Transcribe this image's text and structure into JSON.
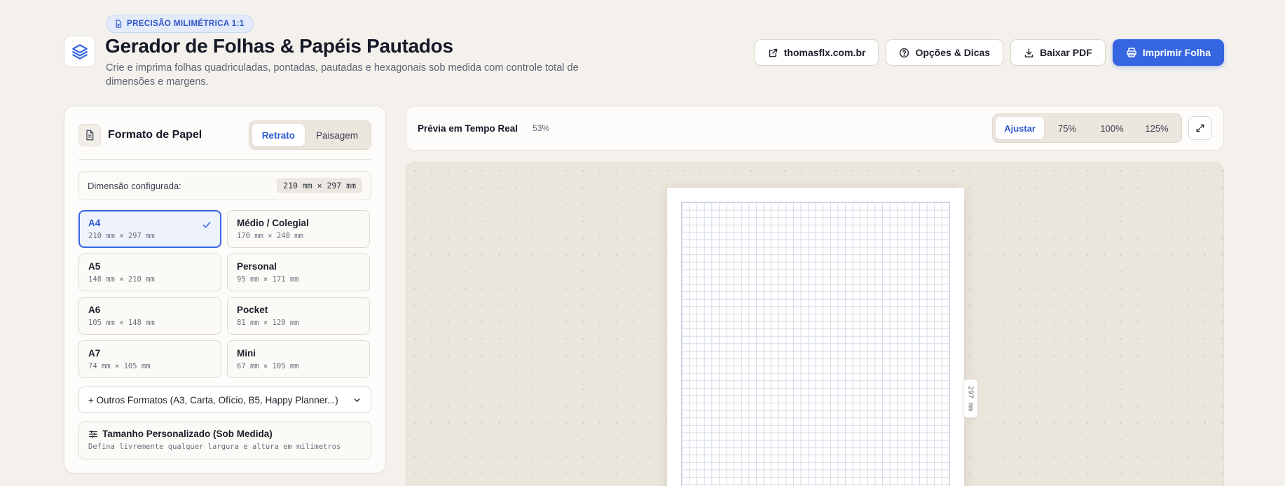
{
  "header": {
    "badge": "PRECISÃO MILIMÉTRICA 1:1",
    "title": "Gerador de Folhas & Papéis Pautados",
    "subtitle": "Crie e imprima folhas quadriculadas, pontadas, pautadas e hexagonais sob medida com controle total de dimensões e margens.",
    "actions": {
      "site": "thomasflx.com.br",
      "tips": "Opções & Dicas",
      "download": "Baixar PDF",
      "print": "Imprimir Folha"
    }
  },
  "paper_panel": {
    "title": "Formato de Papel",
    "orientation": {
      "portrait": "Retrato",
      "landscape": "Paisagem",
      "selected": "Retrato"
    },
    "dimension_label": "Dimensão configurada:",
    "dimension_value": "210 mm × 297 mm",
    "formats": [
      {
        "name": "A4",
        "dims": "210 mm × 297 mm",
        "selected": true
      },
      {
        "name": "Médio / Colegial",
        "dims": "170 mm × 240 mm",
        "selected": false
      },
      {
        "name": "A5",
        "dims": "148 mm × 210 mm",
        "selected": false
      },
      {
        "name": "Personal",
        "dims": "95 mm × 171 mm",
        "selected": false
      },
      {
        "name": "A6",
        "dims": "105 mm × 148 mm",
        "selected": false
      },
      {
        "name": "Pocket",
        "dims": "81 mm × 120 mm",
        "selected": false
      },
      {
        "name": "A7",
        "dims": "74 mm × 105 mm",
        "selected": false
      },
      {
        "name": "Mini",
        "dims": "67 mm × 105 mm",
        "selected": false
      }
    ],
    "more_formats": "+ Outros Formatos (A3, Carta, Ofício, B5, Happy Planner...)",
    "custom": {
      "title": "Tamanho Personalizado (Sob Medida)",
      "description": "Defina livremente qualquer largura e altura em milímetros"
    }
  },
  "preview": {
    "title": "Prévia em Tempo Real",
    "zoom_percent": "53%",
    "zoom_options": [
      "Ajustar",
      "75%",
      "100%",
      "125%"
    ],
    "zoom_selected": "Ajustar",
    "height_label": "297 mm"
  },
  "colors": {
    "accent": "#3565e1",
    "background": "#f4f1ec",
    "grid_line": "#d3dae5"
  }
}
